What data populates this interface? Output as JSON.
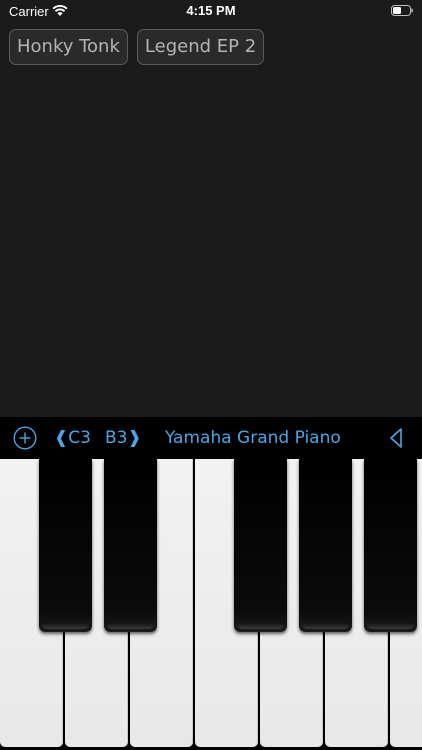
{
  "status_bar": {
    "carrier": "Carrier",
    "time": "4:15 PM",
    "wifi_icon": "wifi-icon",
    "battery_icon": "battery-icon"
  },
  "presets": [
    {
      "label": "Honky Tonk"
    },
    {
      "label": "Legend EP 2"
    }
  ],
  "toolbar": {
    "add_icon": "plus-circle-icon",
    "range_start": "C3",
    "range_end": "B3",
    "range_open_bracket": "❰",
    "range_close_bracket": "❱",
    "instrument": "Yamaha Grand Piano",
    "collapse_icon": "triangle-left-icon"
  },
  "keyboard": {
    "white_keys": 7,
    "black_keys": 5
  },
  "colors": {
    "accent": "#4aa6e6",
    "background": "#1b1b1b",
    "chip_border": "#5a5a5a",
    "chip_text": "#b4b4b4"
  }
}
